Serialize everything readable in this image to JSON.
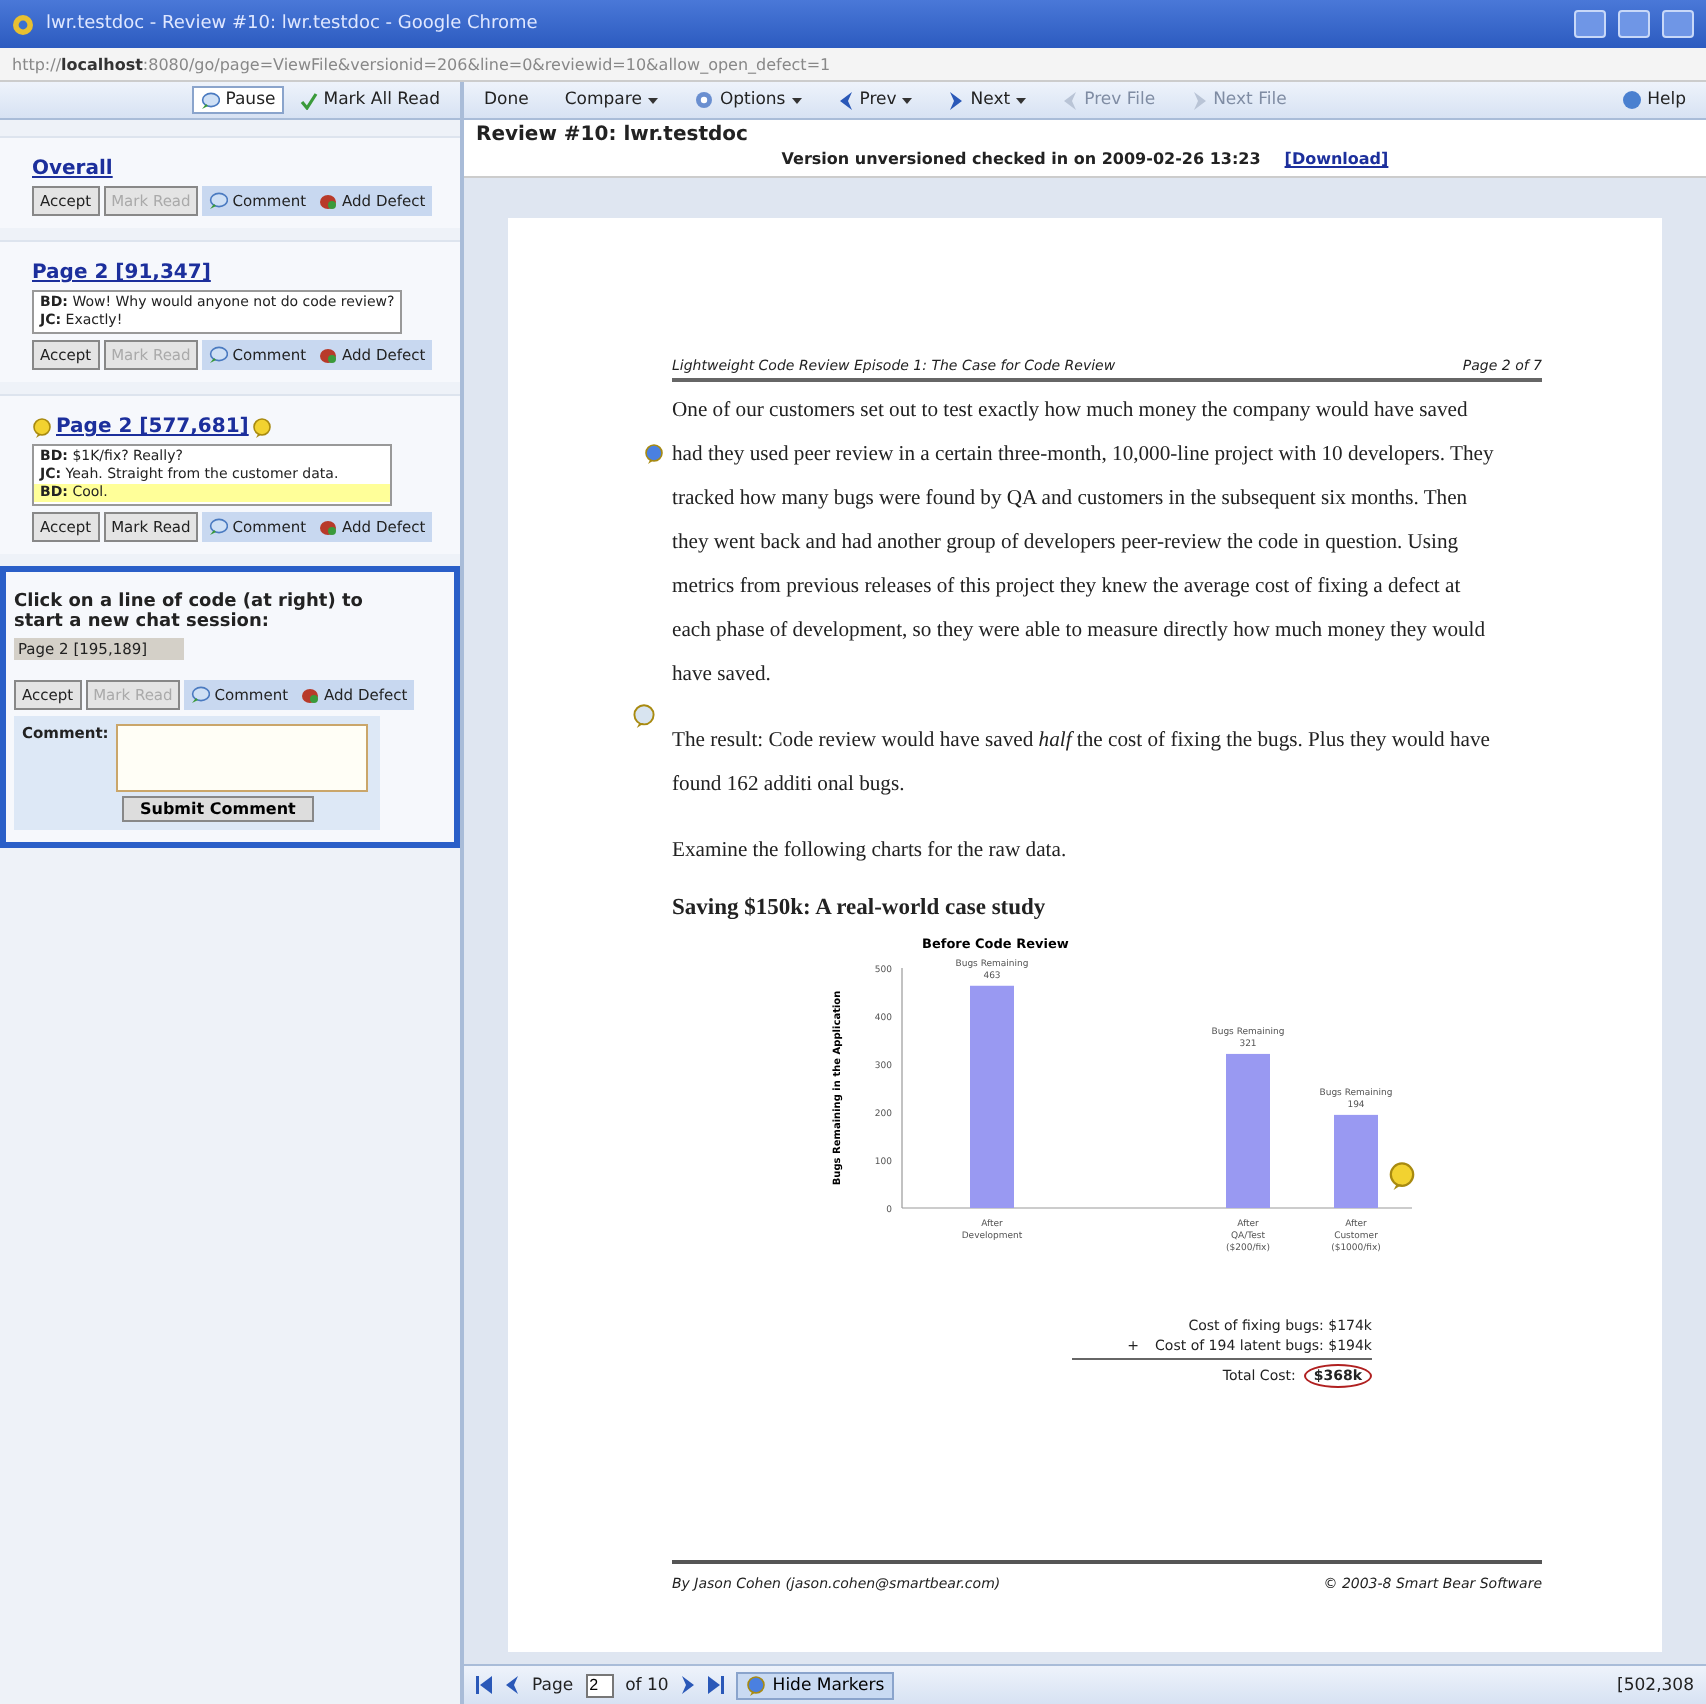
{
  "window": {
    "title": "lwr.testdoc - Review #10: lwr.testdoc - Google Chrome"
  },
  "address_bar": {
    "url": "http://**localhost**:8080/go/page=ViewFile&versionid=206&line=0&reviewid=10&allow_open_defect=1"
  },
  "chat_toolbar": [
    {
      "label": "Pause",
      "kind": "pause",
      "pressed": true
    },
    {
      "label": "Mark All Read",
      "kind": "mark",
      "pressed": false
    }
  ],
  "threads": [
    {
      "title": "Overall",
      "markers": false,
      "buttons": [
        {
          "label": "Accept",
          "kind": "plain",
          "disabled": false
        },
        {
          "label": "Mark Read",
          "kind": "plain",
          "disabled": true
        },
        {
          "label": "Comment",
          "kind": "tab",
          "disabled": false
        },
        {
          "label": "Add Defect",
          "kind": "tab",
          "disabled": false
        }
      ]
    },
    {
      "title": "Page 2 [91,347]",
      "markers": false,
      "messages": [
        {
          "author": "BD:",
          "text": "Wow! Why would anyone not do code review?",
          "highlighted": false
        },
        {
          "author": "JC:",
          "text": "Exactly!",
          "highlighted": false
        }
      ],
      "buttons": [
        {
          "label": "Accept",
          "kind": "plain",
          "disabled": false
        },
        {
          "label": "Mark Read",
          "kind": "plain",
          "disabled": true
        },
        {
          "label": "Comment",
          "kind": "tab",
          "disabled": false
        },
        {
          "label": "Add Defect",
          "kind": "tab",
          "disabled": false
        }
      ]
    },
    {
      "title": "Page 2 [577,681]",
      "markers": true,
      "messages": [
        {
          "author": "BD:",
          "text": "$1K/fix? Really?",
          "highlighted": false
        },
        {
          "author": "JC:",
          "text": "Yeah. Straight from the customer data.",
          "highlighted": false
        },
        {
          "author": "BD:",
          "text": "Cool.",
          "highlighted": true
        }
      ],
      "buttons": [
        {
          "label": "Accept",
          "kind": "plain",
          "disabled": false
        },
        {
          "label": "Mark Read",
          "kind": "plain",
          "disabled": false
        },
        {
          "label": "Comment",
          "kind": "tab",
          "disabled": false
        },
        {
          "label": "Add Defect",
          "kind": "tab",
          "disabled": false
        }
      ]
    }
  ],
  "new_chat": {
    "prompt": "Click on a line of code (at right) to start a new chat session:",
    "location": "Page 2 [195,189]",
    "buttons": [
      {
        "label": "Accept",
        "kind": "plain",
        "disabled": false
      },
      {
        "label": "Mark Read",
        "kind": "plain",
        "disabled": true
      },
      {
        "label": "Comment",
        "kind": "tab",
        "disabled": false
      },
      {
        "label": "Add Defect",
        "kind": "tab",
        "disabled": false
      }
    ],
    "comment_label": "Comment:",
    "submit": "Submit Comment"
  },
  "toolbar": [
    {
      "label": "Done",
      "kind": "plain",
      "dropdown": false,
      "disabled": false
    },
    {
      "label": "Compare",
      "kind": "plain",
      "dropdown": true,
      "disabled": false
    },
    {
      "label": "Options",
      "kind": "options",
      "dropdown": true,
      "disabled": false
    },
    {
      "label": "Prev",
      "kind": "back",
      "dropdown": true,
      "disabled": false
    },
    {
      "label": "Next",
      "kind": "forward",
      "dropdown": true,
      "disabled": false
    },
    {
      "label": "Prev File",
      "kind": "back",
      "dropdown": false,
      "disabled": true
    },
    {
      "label": "Next File",
      "kind": "forward",
      "dropdown": false,
      "disabled": true
    }
  ],
  "help": {
    "label": "Help"
  },
  "review": {
    "title": "Review #10: lwr.testdoc",
    "status": "Version unversioned checked in on 2009-02-26 13:23",
    "link": "[Download]"
  },
  "document": {
    "header_left": "Lightweight Code Review Episode 1: The Case for Code Review",
    "header_right": "Page 2 of 7",
    "paragraphs": [
      "One of our customers set out to test exactly how much money the company would have saved had they used peer review in a certain three-month, 10,000-line project with 10 developers. They tracked how many bugs were found by QA and customers in the subsequent six months.  Then they went back and had another group of developers peer-review the code in question.  Using metrics from previous releases of this project they knew the average cost of fixing a defect at each phase of development, so they were able to measure directly how much money they would have saved.",
      "The result: Code review would have saved *half* the cost of fixing the bugs.  Plus they would have found 162 additi onal bugs.",
      "Examine the following charts for the raw data."
    ],
    "heading": "Saving $150k: A real-world case study",
    "chart_data": {
      "type": "bar",
      "title": "Before Code Review",
      "ylabel": "Bugs Remaining in the Application",
      "categories": [
        "After\nDevelopment",
        "After\nQA/Test\n($200/fix)",
        "After\nCustomer\n($1000/fix)"
      ],
      "values": [
        463,
        321,
        194
      ],
      "ylim": [
        0,
        500
      ],
      "yticks": [
        0,
        100,
        200,
        300,
        400,
        500
      ],
      "value_labels": [
        "Bugs Remaining\n463",
        "Bugs Remaining\n321",
        "Bugs Remaining\n194"
      ]
    },
    "costs": [
      {
        "text": "Cost of fixing bugs: $174k"
      },
      {
        "sign": "+",
        "text": "Cost of 194 latent bugs: $194k"
      }
    ],
    "total_label": "Total Cost:",
    "total": "$368k",
    "footer_left": "By Jason Cohen (jason.cohen@smartbear.com)",
    "footer_right": "© 2003-8 Smart Bear Software"
  },
  "pager": {
    "label": "Page",
    "value": "2",
    "of": "of 10",
    "markers_button": "Hide Markers",
    "markers_pressed": true,
    "coords": "[502,308"
  }
}
